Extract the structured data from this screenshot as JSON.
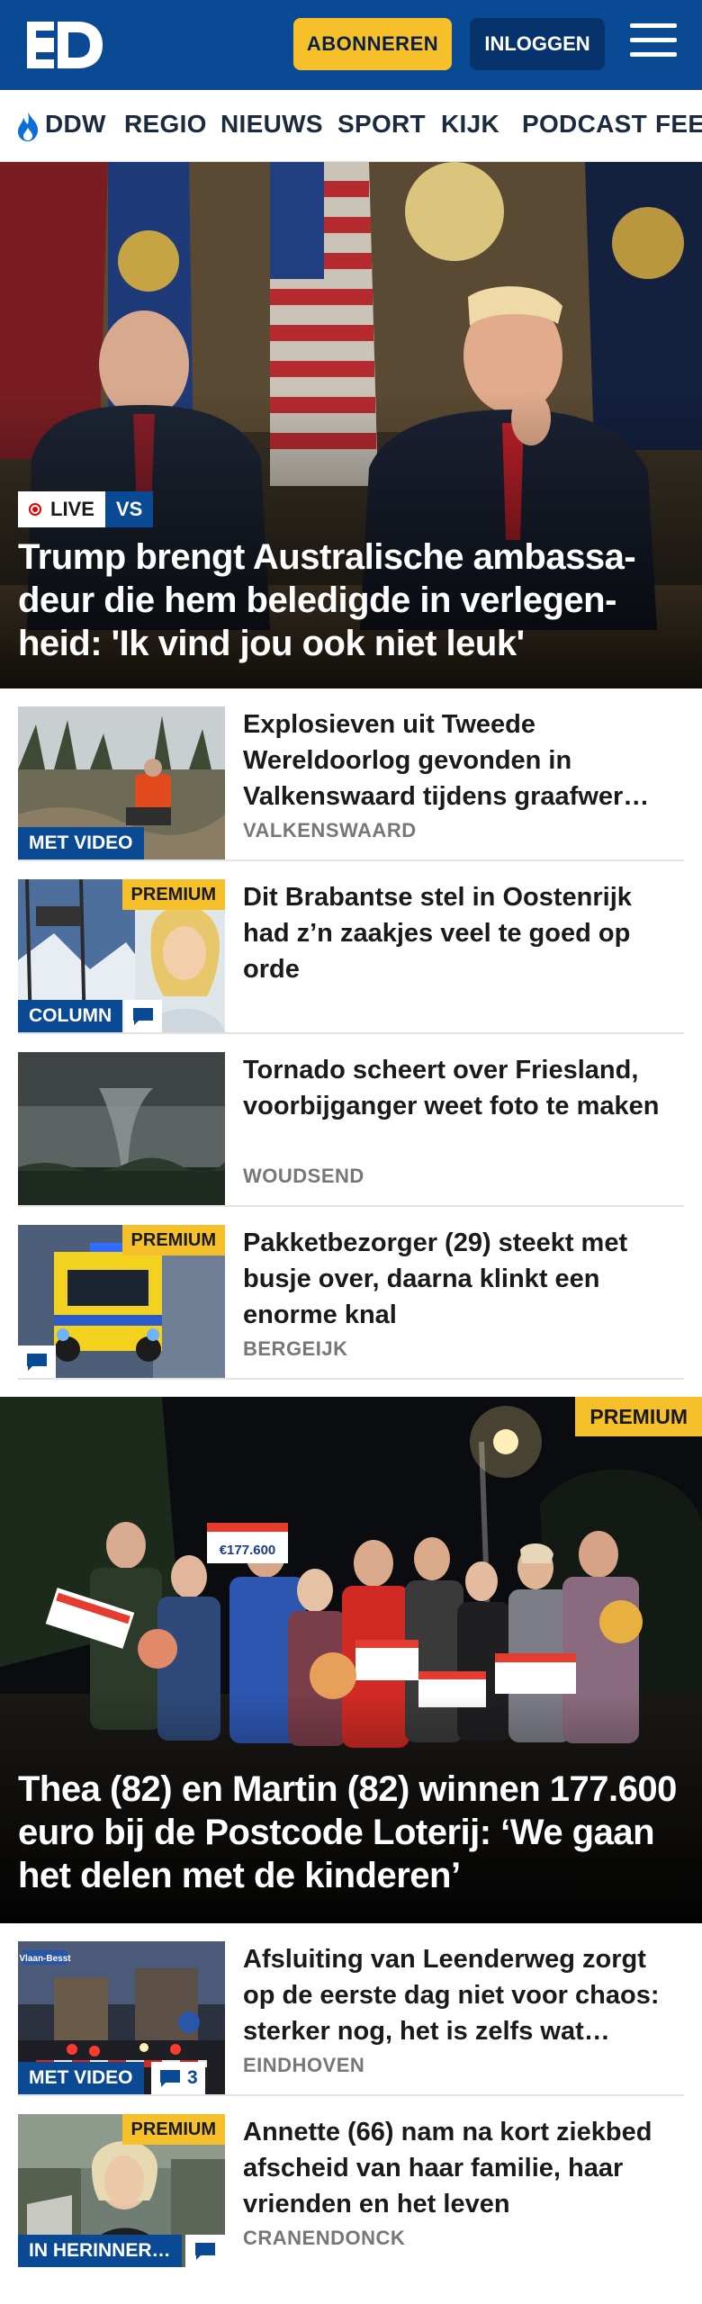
{
  "header": {
    "logo": "ED",
    "subscribe_label": "ABONNEREN",
    "login_label": "INLOGGEN"
  },
  "nav": {
    "items": [
      "DDW",
      "REGIO",
      "NIEUWS",
      "SPORT",
      "KIJK",
      "PODCAST",
      "FEE"
    ]
  },
  "hero": {
    "live_label": "LIVE",
    "topic_label": "VS",
    "title": "Trump brengt Australische ambassa-deur die hem beledigde in verlegen-heid: 'Ik vind jou ook niet leuk'"
  },
  "articles": [
    {
      "title": "Explosieven uit Tweede Wereldoorlog gevonden in Valkenswaard tijdens graafwer…",
      "location": "VALKENSWAARD",
      "video_label": "MET VIDEO"
    },
    {
      "title": "Dit Brabantse stel in Oostenrijk had z’n zaakjes veel te goed op orde",
      "premium_label": "PREMIUM",
      "column_label": "COLUMN"
    },
    {
      "title": "Tornado scheert over Friesland, voorbijganger weet foto te maken",
      "location": "WOUDSEND"
    },
    {
      "title": "Pakketbezorger (29) steekt met busje over, daarna klinkt een enorme knal",
      "location": "BERGEIJK",
      "premium_label": "PREMIUM"
    }
  ],
  "feature": {
    "premium_label": "PREMIUM",
    "title": "Thea (82) en Martin (82) winnen 177.600 euro bij de Postcode Loterij: ‘We gaan het delen met de kinderen’",
    "cheque_text": "€177.600"
  },
  "articles2": [
    {
      "title": "Afsluiting van Leenderweg zorgt op de eerste dag niet voor chaos: sterker nog, het is zelfs wat…",
      "location": "EINDHOVEN",
      "video_label": "MET VIDEO",
      "comment_count": "3",
      "sign_text": "Vlaan-Besst"
    },
    {
      "title": "Annette (66) nam na kort ziekbed afscheid van haar familie, haar vrienden en het leven",
      "location": "CRANENDONCK",
      "premium_label": "PREMIUM",
      "memoriam_label": "IN HERINNER…"
    }
  ],
  "colors": {
    "brand_blue": "#0a4a94",
    "premium_yellow": "#f6c02b"
  }
}
